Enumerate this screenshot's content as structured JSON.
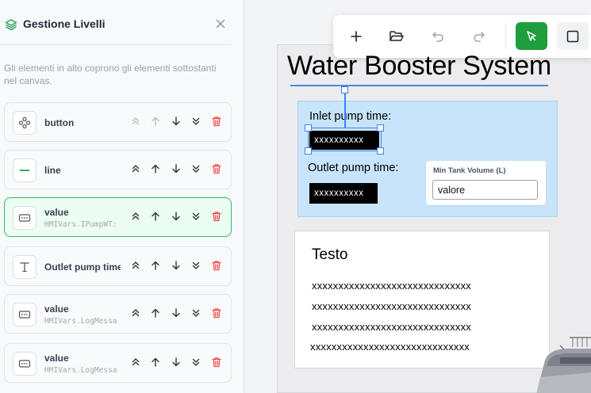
{
  "panel": {
    "title": "Gestione Livelli",
    "description": "Gli elementi in alto coprono gli elementi sottostanti nel canvas.",
    "layers": [
      {
        "name": "button",
        "sub": "",
        "icon": "component-icon",
        "active": false
      },
      {
        "name": "line",
        "sub": "",
        "icon": "line-icon",
        "active": false
      },
      {
        "name": "value",
        "sub": "HMIVars.IPumpWT:",
        "icon": "value-field-icon",
        "active": true
      },
      {
        "name": "Outlet pump time",
        "sub": "",
        "icon": "text-icon",
        "active": false
      },
      {
        "name": "value",
        "sub": "HMIVars.LogMessa",
        "icon": "value-field-icon",
        "active": false
      },
      {
        "name": "value",
        "sub": "HMIVars.LogMessa",
        "icon": "value-field-icon",
        "active": false
      }
    ]
  },
  "toolbar": {
    "tools": [
      "plus-icon",
      "folder-open-icon",
      "undo-icon",
      "redo-icon",
      "select-pointer-icon",
      "rectangle-icon"
    ]
  },
  "canvas": {
    "title": "Water Booster System",
    "inlet_label": "Inlet pump time:",
    "inlet_value": "xxxxxxxxxx",
    "outlet_label": "Outlet pump time:",
    "outlet_value": "xxxxxxxxxx",
    "tank_label": "Min Tank Volume (L)",
    "tank_value": "valore",
    "text_title": "Testo",
    "text_lines": [
      "xxxxxxxxxxxxxxxxxxxxxxxxxxxxxx",
      "xxxxxxxxxxxxxxxxxxxxxxxxxxxxxx",
      "xxxxxxxxxxxxxxxxxxxxxxxxxxxxxx",
      "xxxxxxxxxxxxxxxxxxxxxxxxxxxxxx"
    ]
  },
  "colors": {
    "accent_green": "#1e9e3c",
    "selection_blue": "#3b82f6",
    "group_blue": "#c7e4fb",
    "delete_red": "#ef4444"
  }
}
